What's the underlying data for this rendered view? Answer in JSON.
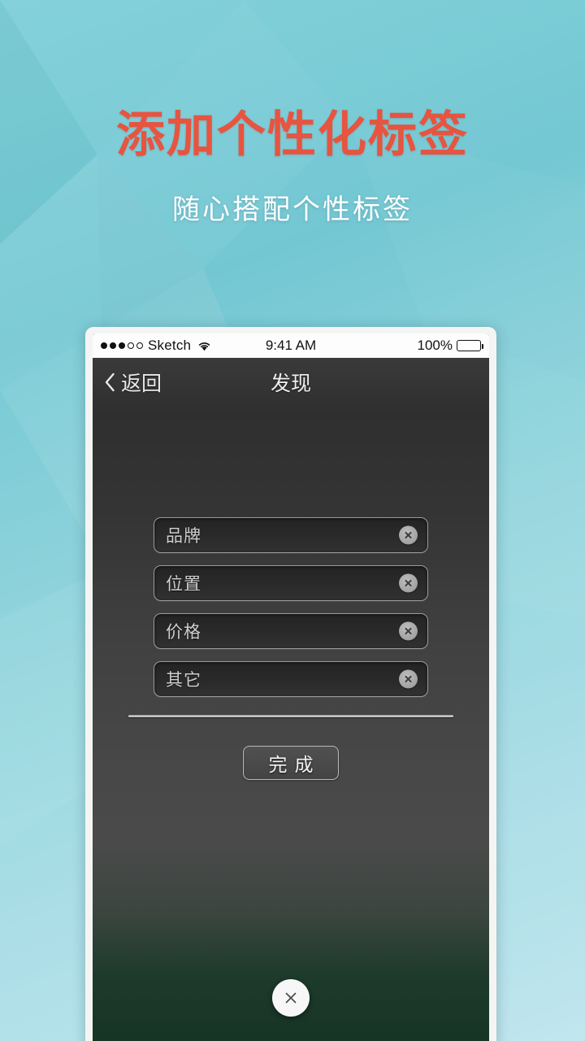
{
  "hero": {
    "title": "添加个性化标签",
    "subtitle": "随心搭配个性标签",
    "title_color": "#e75440",
    "subtitle_color": "#ffffff"
  },
  "phone": {
    "status_bar": {
      "carrier": "Sketch",
      "signal_dots_filled": 3,
      "signal_dots_total": 5,
      "wifi_icon": "wifi-icon",
      "time": "9:41 AM",
      "battery_percent": "100%",
      "battery_icon": "battery-full-icon"
    },
    "nav_bar": {
      "back_icon": "chevron-left-icon",
      "back_label": "返回",
      "title": "发现"
    },
    "form": {
      "fields": [
        {
          "label": "品牌",
          "clear_icon": "clear-circle-icon"
        },
        {
          "label": "位置",
          "clear_icon": "clear-circle-icon"
        },
        {
          "label": "价格",
          "clear_icon": "clear-circle-icon"
        },
        {
          "label": "其它",
          "clear_icon": "clear-circle-icon"
        }
      ],
      "done_label": "完成"
    },
    "close_button": {
      "icon": "close-x-icon"
    }
  }
}
